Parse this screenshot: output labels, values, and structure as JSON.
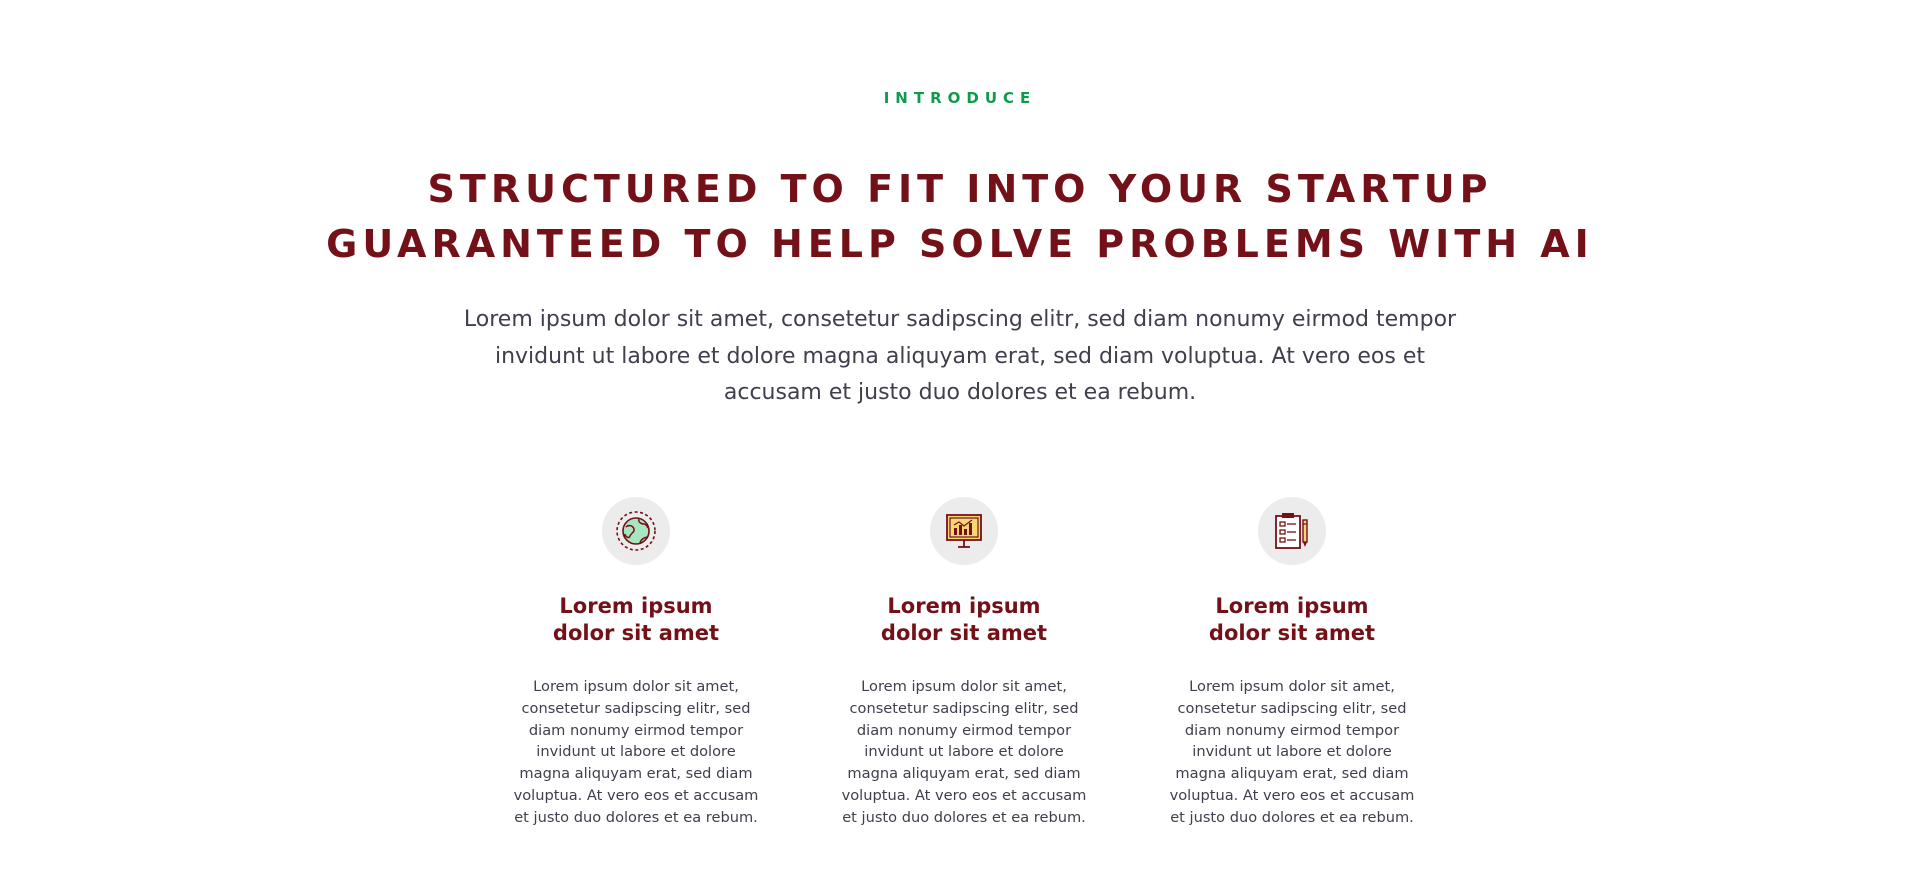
{
  "section": {
    "eyebrow": "INTRODUCE",
    "headline": {
      "line1": "STRUCTURED TO FIT INTO YOUR STARTUP",
      "line2": "GUARANTEED TO HELP SOLVE PROBLEMS WITH AI"
    },
    "intro": "Lorem ipsum dolor sit amet, consetetur sadipscing elitr, sed diam nonumy eirmod tempor invidunt ut labore et dolore magna aliquyam erat, sed diam voluptua. At vero eos et accusam et justo duo dolores et ea rebum."
  },
  "features": [
    {
      "icon": "globe-icon",
      "title_line1": "Lorem ipsum",
      "title_line2": "dolor sit amet",
      "text": "Lorem ipsum dolor sit amet, consetetur sadipscing elitr, sed diam nonumy eirmod tempor invidunt ut labore et dolore magna aliquyam erat, sed diam voluptua. At vero eos et accusam et justo duo dolores et ea rebum."
    },
    {
      "icon": "presentation-chart-icon",
      "title_line1": "Lorem ipsum",
      "title_line2": "dolor sit amet",
      "text": "Lorem ipsum dolor sit amet, consetetur sadipscing elitr, sed diam nonumy eirmod tempor invidunt ut labore et dolore magna aliquyam erat, sed diam voluptua. At vero eos et accusam et justo duo dolores et ea rebum."
    },
    {
      "icon": "clipboard-pen-icon",
      "title_line1": "Lorem ipsum",
      "title_line2": "dolor sit amet",
      "text": "Lorem ipsum dolor sit amet, consetetur sadipscing elitr, sed diam nonumy eirmod tempor invidunt ut labore et dolore magna aliquyam erat, sed diam voluptua. At vero eos et accusam et justo duo dolores et ea rebum."
    }
  ],
  "colors": {
    "accent_green": "#0f9a4c",
    "brand_maroon": "#741017",
    "body_text": "#3f3f4d",
    "icon_circle_bg": "#ececec",
    "icon_fill_mint": "#a8e6c2",
    "icon_fill_yellow": "#f7d774"
  }
}
